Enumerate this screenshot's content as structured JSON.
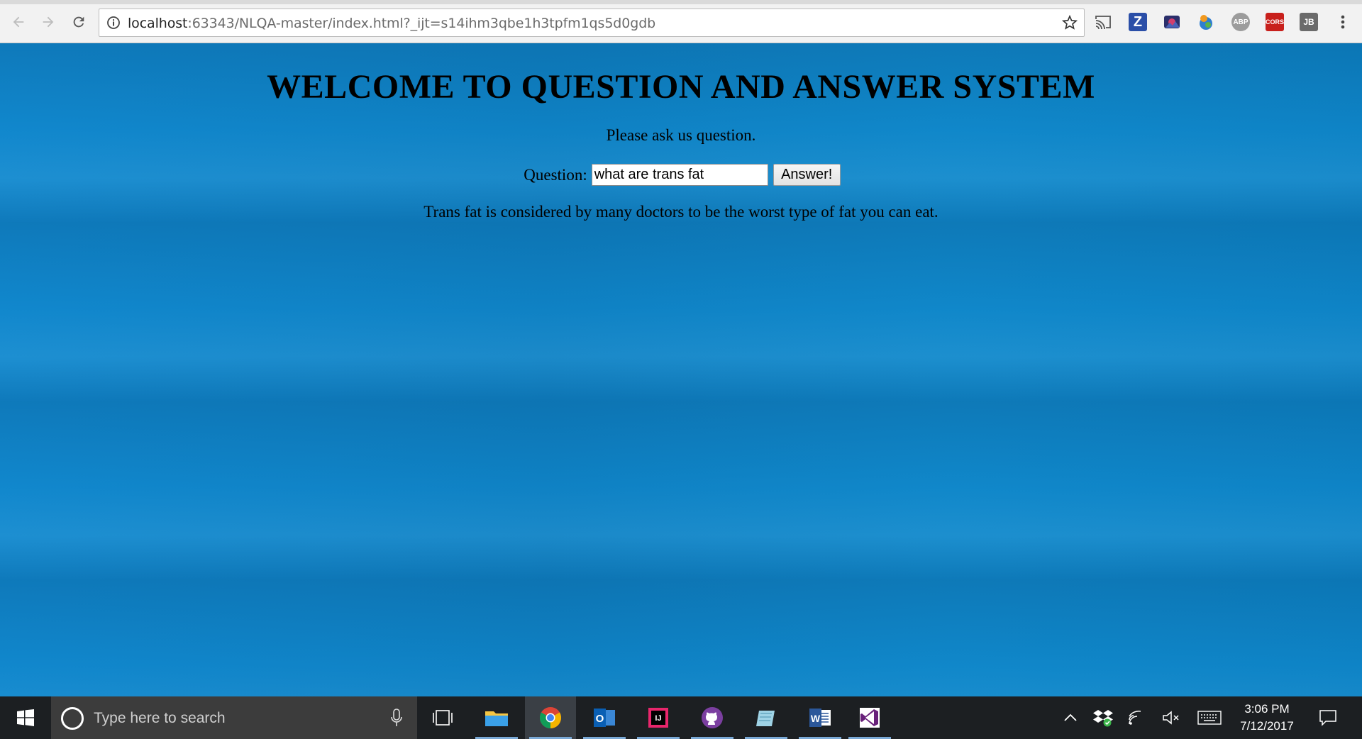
{
  "browser": {
    "url_host": "localhost",
    "url_rest": ":63343/NLQA-master/index.html?_ijt=s14ihm3qbe1h3tpfm1qs5d0gdb",
    "nav_icons": [
      "back-arrow-icon",
      "forward-arrow-icon",
      "reload-icon"
    ],
    "extensions": [
      {
        "name": "cast-icon"
      },
      {
        "name": "zotero-icon",
        "text": "Z",
        "color": "#2b4fa8"
      },
      {
        "name": "extension-icon-2"
      },
      {
        "name": "extension-icon-3"
      },
      {
        "name": "adblock-plus-icon",
        "text": "ABP",
        "color": "#9c9c9c"
      },
      {
        "name": "cors-icon",
        "text": "CORS",
        "color": "#c8201c"
      },
      {
        "name": "jetbrains-icon",
        "text": "JB",
        "color": "#6b6b6b"
      }
    ]
  },
  "page": {
    "heading": "WELCOME TO QUESTION AND ANSWER SYSTEM",
    "prompt": "Please ask us question.",
    "question_label": "Question:",
    "question_value": "what are trans fat",
    "answer_button": "Answer!",
    "answer_text": "Trans fat is considered by many doctors to be the worst type of fat you can eat."
  },
  "taskbar": {
    "search_placeholder": "Type here to search",
    "apps": [
      "task-view-icon",
      "file-explorer-icon",
      "chrome-icon",
      "outlook-icon",
      "intellij-icon",
      "github-desktop-icon",
      "notepad-app-icon",
      "word-icon",
      "visual-studio-icon"
    ],
    "time": "3:06 PM",
    "date": "7/12/2017"
  },
  "colors": {
    "page_background": "#0e86c9",
    "taskbar": "#1c1f22"
  }
}
